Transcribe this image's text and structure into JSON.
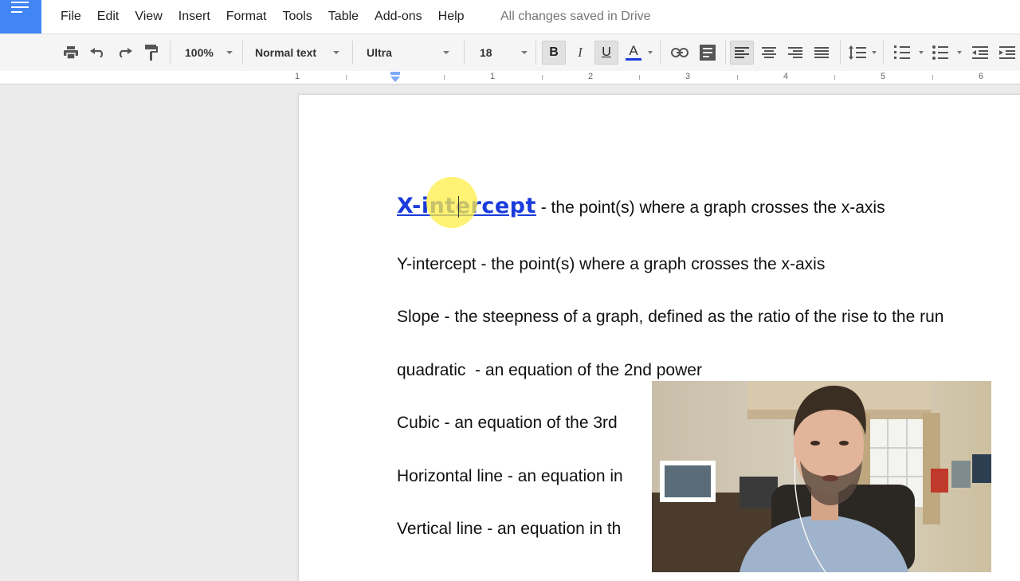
{
  "menubar": {
    "items": [
      "File",
      "Edit",
      "View",
      "Insert",
      "Format",
      "Tools",
      "Table",
      "Add-ons",
      "Help"
    ],
    "save_status": "All changes saved in Drive"
  },
  "toolbar": {
    "zoom": "100%",
    "style": "Normal text",
    "font": "Ultra",
    "font_size": "18",
    "bold_label": "B",
    "italic_label": "I",
    "underline_label": "U",
    "text_color_label": "A",
    "text_color": "#1a3cdc"
  },
  "ruler": {
    "numbers": [
      "1",
      "1",
      "2",
      "3",
      "4",
      "5",
      "6"
    ]
  },
  "document": {
    "paragraphs": [
      {
        "term": "X-intercept",
        "definition": " - the point(s) where a graph crosses the x-axis"
      },
      {
        "term": "Y-intercept",
        "definition": " - the point(s) where a graph crosses the x-axis"
      },
      {
        "term": "Slope",
        "definition": " - the steepness of a graph, defined as the ratio of the rise to the run"
      },
      {
        "term": "quadratic",
        "definition": "  - an equation of the 2nd power"
      },
      {
        "term": "Cubic",
        "definition": " - an equation of the 3rd"
      },
      {
        "term": "Horizontal line",
        "definition": " - an equation in"
      },
      {
        "term": "Vertical line",
        "definition": " - an equation in th"
      }
    ]
  },
  "colors": {
    "brand_blue": "#4285f4",
    "highlight_yellow": "#ffee46"
  }
}
